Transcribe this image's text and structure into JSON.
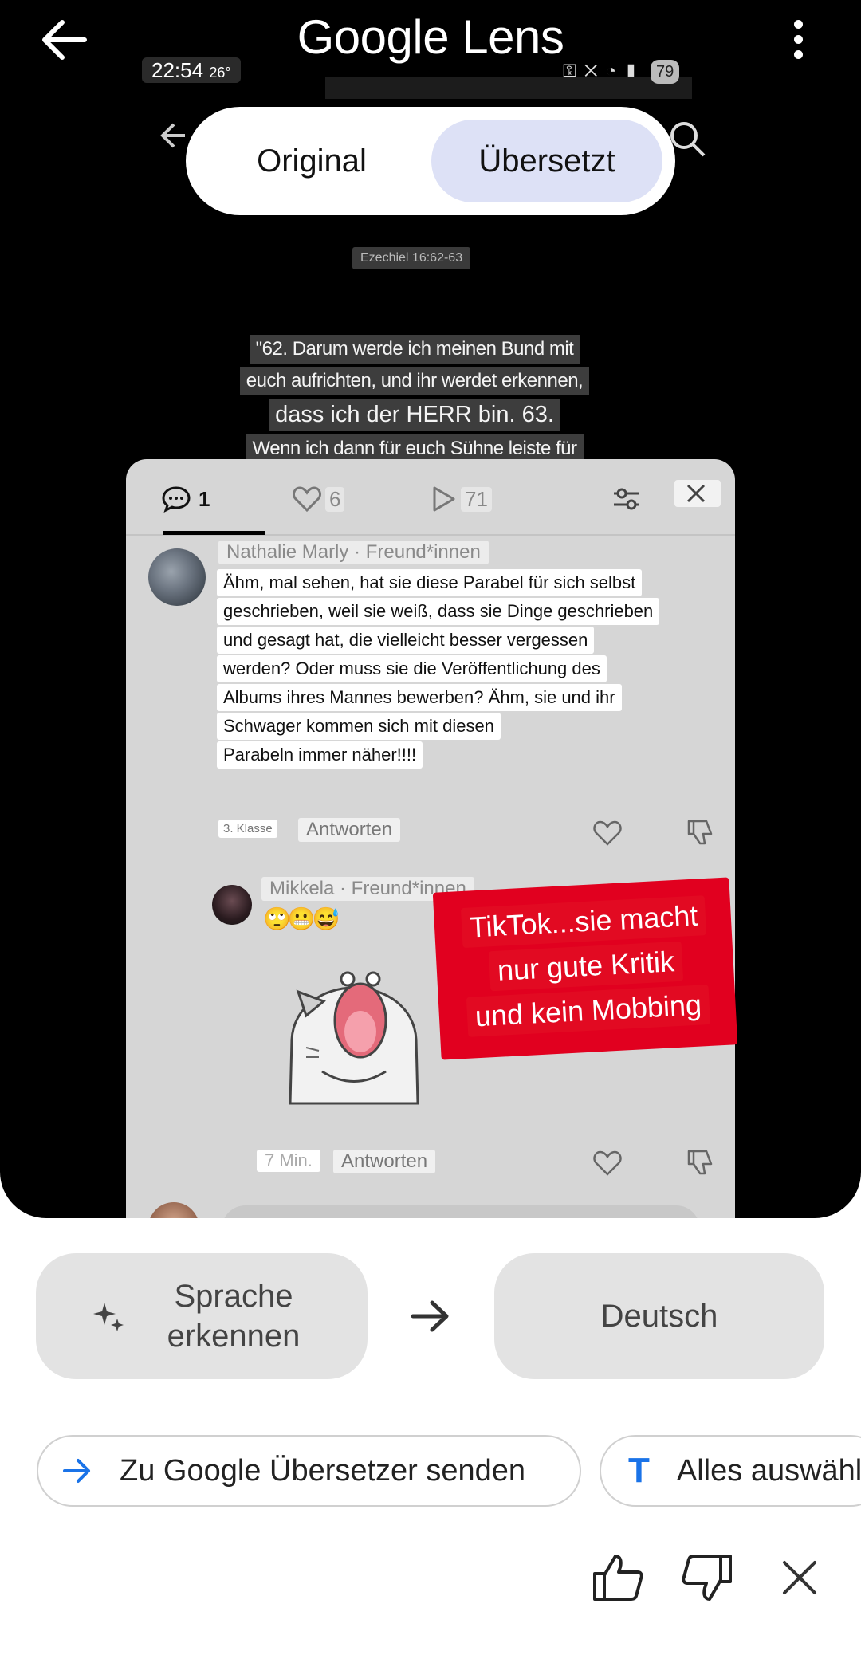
{
  "app": {
    "title": "Google Lens"
  },
  "screenshot_status": {
    "time": "22:54",
    "temp": "26°",
    "battery": "79"
  },
  "view_toggle": {
    "original": "Original",
    "translated": "Übersetzt",
    "selected": "translated"
  },
  "verse": {
    "reference": "Ezechiel 16:62-63",
    "lines": [
      "\"62. Darum werde ich meinen Bund mit",
      "euch aufrichten, und ihr werdet erkennen,",
      "dass ich der HERR bin. 63.",
      "Wenn ich dann für euch Sühne leiste für"
    ]
  },
  "comments_panel": {
    "tabs": {
      "comments_count": "1",
      "likes_count": "6",
      "plays_count": "71"
    },
    "comments": [
      {
        "author": "Nathalie Marly · Freund*innen",
        "lines": [
          "Ähm, mal sehen, hat sie diese Parabel für sich selbst",
          "geschrieben, weil sie weiß, dass sie Dinge geschrieben",
          "und gesagt hat, die vielleicht besser vergessen",
          "werden? Oder muss sie die Veröffentlichung des",
          "Albums ihres Mannes bewerben? Ähm, sie und ihr",
          "Schwager kommen sich mit diesen",
          "Parabeln immer näher!!!!"
        ],
        "tag": "3. Klasse",
        "reply": "Antworten"
      },
      {
        "author": "Mikkela · Freund*innen",
        "emojis": "🙄😬😅",
        "time": "7 Min.",
        "reply": "Antworten"
      }
    ],
    "overlay_caption": [
      "TikTok...sie macht",
      "nur gute Kritik",
      "und kein Mobbing"
    ]
  },
  "language_bar": {
    "source": "Sprache erkennen",
    "target": "Deutsch"
  },
  "actions": {
    "send_to_translate": "Zu Google Übersetzer senden",
    "select_all": "Alles auswählen"
  },
  "colors": {
    "accent": "#1a73e8",
    "toggle_selected": "#dde1f6",
    "overlay_red": "#e20a22"
  }
}
